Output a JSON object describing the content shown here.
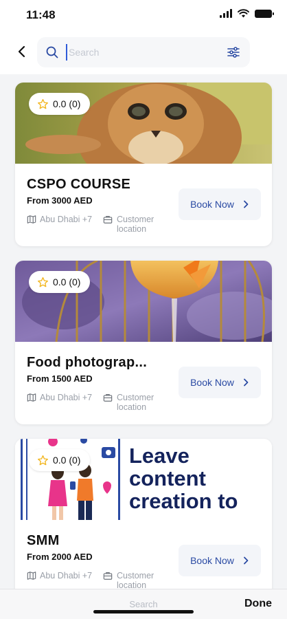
{
  "status_bar": {
    "time": "11:48"
  },
  "header": {
    "search_placeholder": "Search"
  },
  "cards": [
    {
      "rating": "0.0 (0)",
      "title": "CSPO COURSE",
      "price": "From 3000 AED",
      "location": "Abu Dhabi +7",
      "location_type": "Customer location",
      "book_label": "Book Now"
    },
    {
      "rating": "0.0 (0)",
      "title": "Food photograp...",
      "price": "From 1500 AED",
      "location": "Abu Dhabi +7",
      "location_type": "Customer location",
      "book_label": "Book Now"
    },
    {
      "rating": "0.0 (0)",
      "title": "SMM",
      "price": "From 2000 AED",
      "location": "Abu Dhabi +7",
      "location_type": "Customer location",
      "book_label": "Book Now",
      "banner_lines": [
        "Leave",
        "content",
        "creation to"
      ]
    }
  ],
  "keyboard_bar": {
    "search_label": "Search",
    "done_label": "Done"
  },
  "colors": {
    "accent": "#2a4aa3",
    "background": "#f3f4f6",
    "banner_text": "#14235c"
  }
}
